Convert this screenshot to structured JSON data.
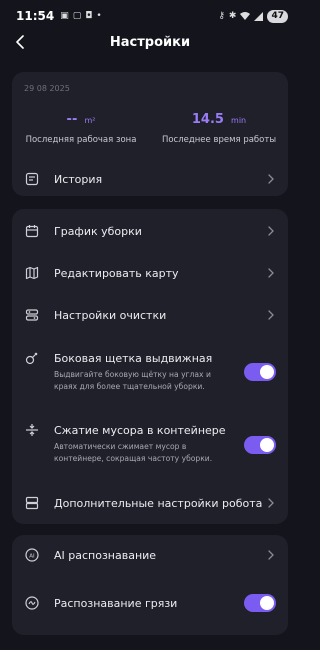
{
  "status_bar": {
    "time": "11:54",
    "battery": "47"
  },
  "header": {
    "title": "Настройки"
  },
  "summary": {
    "date": "29 08 2025",
    "last_area_value": "--",
    "last_area_unit": "m²",
    "last_area_label": "Последняя рабочая зона",
    "last_time_value": "14.5",
    "last_time_unit": "min",
    "last_time_label": "Последнее время работы",
    "history_label": "История"
  },
  "settings": {
    "schedule_label": "График уборки",
    "edit_map_label": "Редактировать карту",
    "cleaning_settings_label": "Настройки очистки",
    "side_brush": {
      "label": "Боковая щетка выдвижная",
      "description": "Выдвигайте боковую щётку на углах и краях для более тщательной уборки.",
      "enabled": true
    },
    "compression": {
      "label": "Сжатие мусора в контейнере",
      "description": "Автоматически сжимает мусор в контейнере, сокращая частоту уборки.",
      "enabled": true
    },
    "advanced_label": "Дополнительные настройки робота"
  },
  "ai": {
    "ai_recognition_label": "AI распознавание",
    "dirt_recognition_label": "Распознавание грязи",
    "dirt_recognition_enabled": true
  },
  "colors": {
    "accent": "#7b5cf0",
    "value_text": "#9a7cf5",
    "background": "#14151c",
    "card": "#1f2029"
  }
}
